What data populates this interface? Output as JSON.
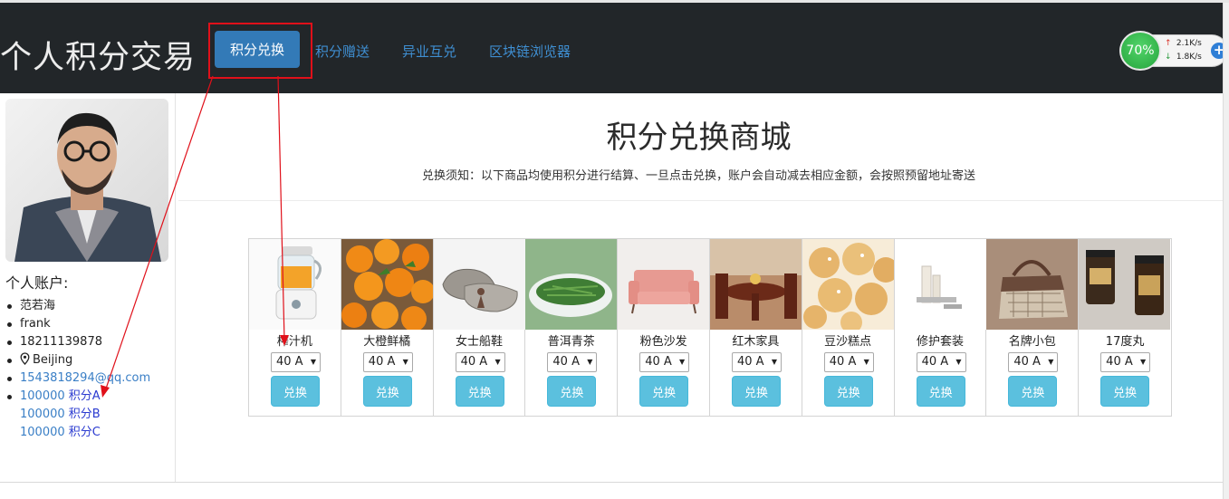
{
  "navbar": {
    "brand": "个人积分交易",
    "active_tab": "积分兑换",
    "links": [
      "积分赠送",
      "异业互兑",
      "区块链浏览器"
    ]
  },
  "speed_widget": {
    "percent": "70%",
    "up": "2.1K/s",
    "down": "1.8K/s"
  },
  "sidebar": {
    "account_title": "个人账户:",
    "name_cn": "范若海",
    "name_en": "frank",
    "phone": "18211139878",
    "location": "Beijing",
    "email": "1543818294@qq.com",
    "points": [
      {
        "amount": "100000",
        "label": "积分A"
      },
      {
        "amount": "100000",
        "label": "积分B"
      },
      {
        "amount": "100000",
        "label": "积分C"
      }
    ]
  },
  "main": {
    "title": "积分兑换商城",
    "notice": "兑换须知：以下商品均使用积分进行结算、一旦点击兑换，账户会自动减去相应金额，会按照预留地址寄送",
    "select_value": "40 A",
    "button_label": "兑换"
  },
  "products": [
    {
      "name": "榨汁机",
      "icon": "juicer"
    },
    {
      "name": "大橙鲜橘",
      "icon": "oranges"
    },
    {
      "name": "女士船鞋",
      "icon": "shoes"
    },
    {
      "name": "普洱青茶",
      "icon": "tea"
    },
    {
      "name": "粉色沙发",
      "icon": "sofa"
    },
    {
      "name": "红木家具",
      "icon": "furniture"
    },
    {
      "name": "豆沙糕点",
      "icon": "pastry"
    },
    {
      "name": "修护套装",
      "icon": "skincare"
    },
    {
      "name": "名牌小包",
      "icon": "handbag"
    },
    {
      "name": "17度丸",
      "icon": "coffee-jars"
    }
  ],
  "colors": {
    "navbar": "#222629",
    "active": "#337ab7",
    "link": "#3f8fd2",
    "button": "#5bc0de",
    "annotation": "#e0101a"
  }
}
